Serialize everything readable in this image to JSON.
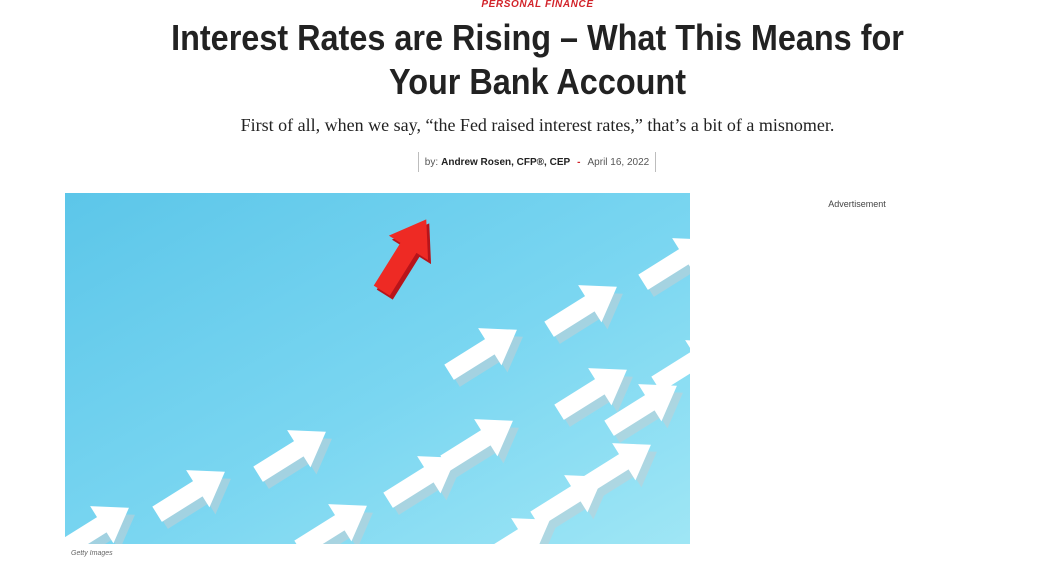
{
  "article": {
    "category": "PERSONAL FINANCE",
    "headline": "Interest Rates are Rising – What This Means for Your Bank Account",
    "dek": "First of all, when we say, “the Fed raised interest rates,” that’s a bit of a misnomer.",
    "byline": {
      "prefix": "by:",
      "author": "Andrew Rosen, CFP®, CEP",
      "separator": "-",
      "date": "April 16, 2022"
    }
  },
  "hero_image": {
    "subject": "white arrows pointing up-right on blue background with one red arrow leading",
    "credit": "Getty Images",
    "colors": {
      "background_light": "#9fe6f5",
      "background_dark": "#5cc6e9",
      "arrow_white": "#ffffff",
      "arrow_red": "#ee2a24"
    }
  },
  "sidebar": {
    "ad_label": "Advertisement"
  },
  "colors": {
    "accent": "#d2232a",
    "text": "#222222"
  }
}
